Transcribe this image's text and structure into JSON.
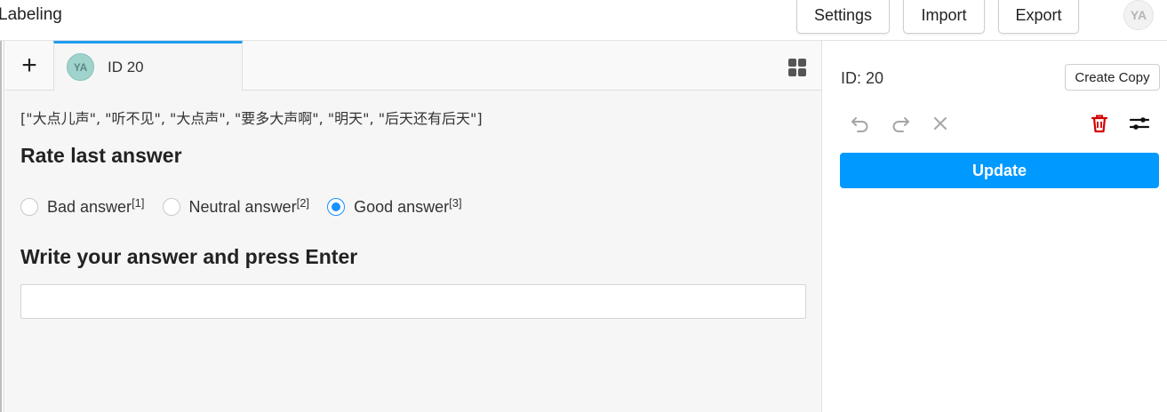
{
  "header": {
    "title": "Labeling",
    "buttons": {
      "settings": "Settings",
      "import": "Import",
      "export": "Export"
    },
    "user_initials": "YA"
  },
  "tabs": {
    "add_label": "+",
    "active": {
      "avatar_initials": "YA",
      "label": "ID 20"
    }
  },
  "task": {
    "text": "[\"大点儿声\", \"听不见\", \"大点声\", \"要多大声啊\", \"明天\", \"后天还有后天\"]",
    "rating_heading": "Rate last answer",
    "choices": [
      {
        "label": "Bad answer",
        "hotkey": "[1]",
        "selected": false
      },
      {
        "label": "Neutral answer",
        "hotkey": "[2]",
        "selected": false
      },
      {
        "label": "Good answer",
        "hotkey": "[3]",
        "selected": true
      }
    ],
    "answer_heading": "Write your answer and press Enter",
    "answer_value": ""
  },
  "sidebar": {
    "id_label": "ID: 20",
    "create_copy": "Create Copy",
    "tools": [
      "undo-icon",
      "redo-icon",
      "reset-icon",
      "delete-icon",
      "settings-sliders-icon"
    ],
    "update": "Update",
    "colors": {
      "accent": "#0099ff",
      "delete": "#d40000",
      "tab_border": "#1e9cf0",
      "radio": "#1890ff"
    }
  }
}
